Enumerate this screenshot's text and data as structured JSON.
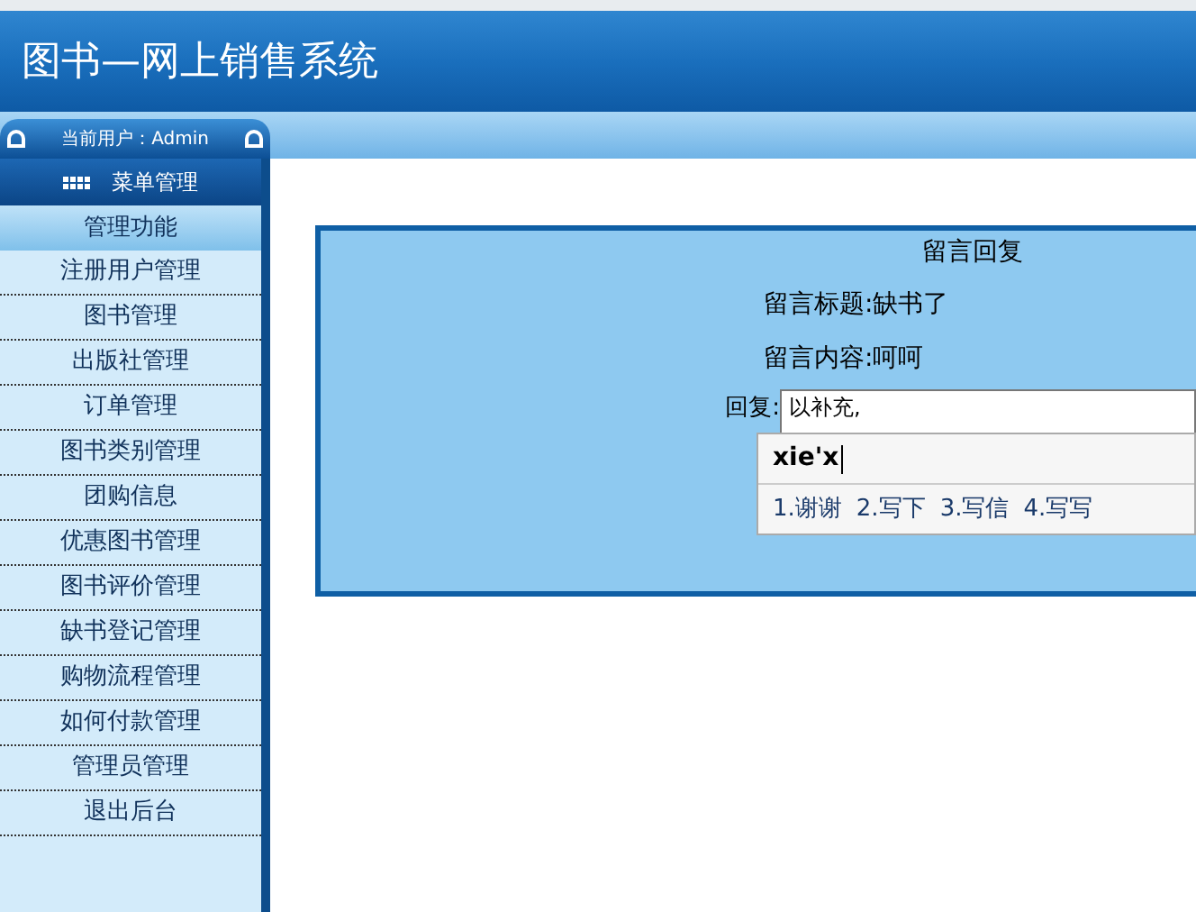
{
  "header": {
    "title": "图书—网上销售系统"
  },
  "user_bar": {
    "label": "当前用户：Admin"
  },
  "sidebar": {
    "menu_title": "菜单管理",
    "section": "管理功能",
    "items": [
      {
        "label": "注册用户管理"
      },
      {
        "label": "图书管理"
      },
      {
        "label": "出版社管理"
      },
      {
        "label": "订单管理"
      },
      {
        "label": "图书类别管理"
      },
      {
        "label": "团购信息"
      },
      {
        "label": "优惠图书管理"
      },
      {
        "label": "图书评价管理"
      },
      {
        "label": "缺书登记管理"
      },
      {
        "label": "购物流程管理"
      },
      {
        "label": "如何付款管理"
      },
      {
        "label": "管理员管理"
      },
      {
        "label": "退出后台"
      }
    ]
  },
  "reply_form": {
    "title": "留言回复",
    "fields": [
      {
        "label": "留言标题:",
        "value": "缺书了"
      },
      {
        "label": "留言内容:",
        "value": "呵呵"
      }
    ],
    "reply_label": "回复:",
    "reply_value": "以补充,"
  },
  "ime_popup": {
    "composition": "xie'x",
    "candidates": [
      "1.谢谢",
      "2.写下",
      "3.写信",
      "4.写写"
    ]
  }
}
